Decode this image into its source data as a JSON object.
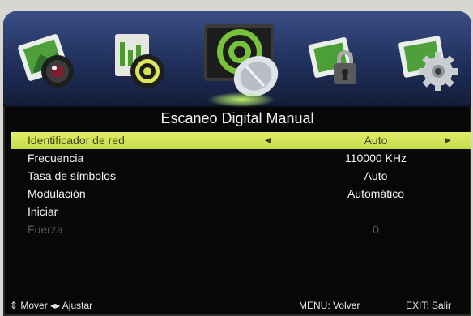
{
  "menu_icons": [
    {
      "name": "picture-menu-icon"
    },
    {
      "name": "sound-menu-icon"
    },
    {
      "name": "channel-menu-icon"
    },
    {
      "name": "lock-menu-icon"
    },
    {
      "name": "setup-menu-icon"
    }
  ],
  "active_menu_index": 2,
  "title": "Escaneo Digital Manual",
  "rows": [
    {
      "label": "Identificador de red",
      "value": "Auto",
      "selected": true
    },
    {
      "label": "Frecuencia",
      "value": "110000 KHz"
    },
    {
      "label": "Tasa de símbolos",
      "value": "Auto"
    },
    {
      "label": "Modulación",
      "value": "Automático"
    },
    {
      "label": "Iniciar",
      "value": ""
    },
    {
      "label": "Fuerza",
      "value": "0",
      "disabled": true
    }
  ],
  "arrows": {
    "left": "◀",
    "right": "▶"
  },
  "footer": {
    "move_hint": "⇕ Mover  ◂▸ Ajustar",
    "menu_hint": "MENU: Volver",
    "exit_hint": "EXIT: Salir"
  },
  "colors": {
    "highlight": "#d4e55a",
    "background": "#070707",
    "icon_bar": "#26365f",
    "disabled_text": "#575757"
  }
}
